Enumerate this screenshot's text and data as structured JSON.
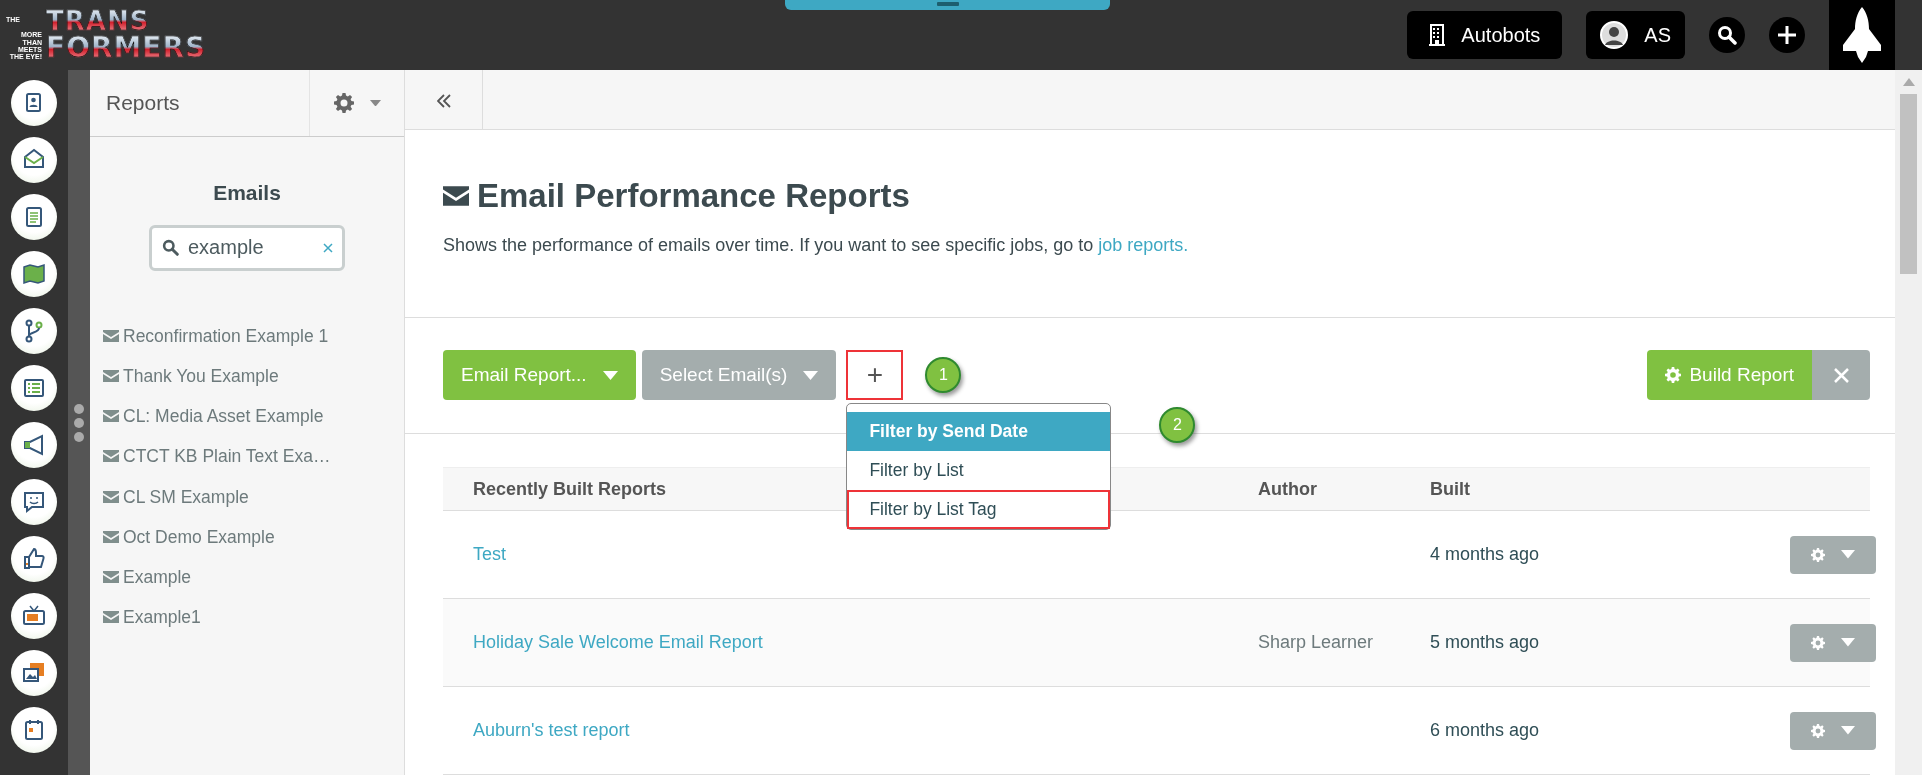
{
  "logo": {
    "prefix": "THE",
    "line1": "TRANS",
    "line2": "FORMERS",
    "tagline": "MORE THAN MEETS THE EYE!"
  },
  "top_bar": {
    "account": "Autobots",
    "user": "AS"
  },
  "sidebar": {
    "title": "Reports",
    "heading": "Emails",
    "search": {
      "value": "example"
    },
    "items": [
      "Reconfirmation Example 1",
      "Thank You Example",
      "CL: Media Asset Example",
      "CTCT KB Plain Text Exa…",
      "CL SM Example",
      "Oct Demo Example",
      "Example",
      "Example1"
    ]
  },
  "page": {
    "title": "Email Performance Reports",
    "description": "Shows the performance of emails over time. If you want to see specific jobs, go to",
    "link": "job reports."
  },
  "toolbar": {
    "buttons": [
      {
        "label": "Email Report...",
        "kind": "primary"
      },
      {
        "label": "Select Email(s)",
        "kind": "secondary"
      }
    ],
    "add": {
      "label": "+",
      "highlighted": true
    },
    "build": "Build Report"
  },
  "filter_menu": {
    "items": [
      {
        "label": "Filter by Send Date",
        "selected": true,
        "highlighted": false
      },
      {
        "label": "Filter by List",
        "selected": false,
        "highlighted": false
      },
      {
        "label": "Filter by List Tag",
        "selected": false,
        "highlighted": true
      }
    ]
  },
  "callouts": [
    "1",
    "2"
  ],
  "table": {
    "columns": [
      "Recently Built Reports",
      "Author",
      "Built"
    ],
    "rows": [
      {
        "name": "Test",
        "built": "4 months ago"
      },
      {
        "name": "Holiday Sale Welcome Email Report",
        "author": "Sharp Learner",
        "built": "5 months ago"
      },
      {
        "name": "Auburn's test report",
        "built": "6 months ago"
      }
    ]
  }
}
